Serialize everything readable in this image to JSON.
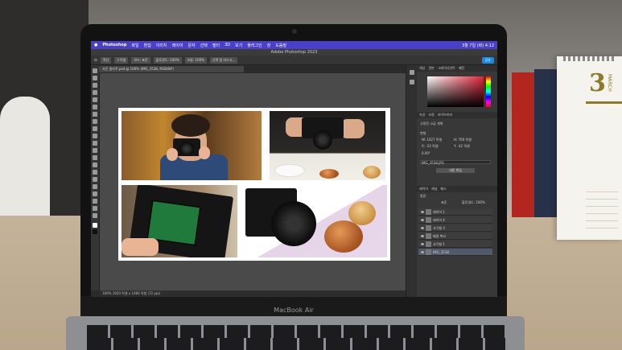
{
  "ps": {
    "menubar": {
      "app_name": "Photoshop",
      "items": [
        "파일",
        "편집",
        "이미지",
        "레이어",
        "문자",
        "선택",
        "필터",
        "3D",
        "보기",
        "플러그인",
        "창",
        "도움말"
      ],
      "clock": "3월 7일 (화) 4:12"
    },
    "window_title": "Adobe Photoshop 2023",
    "doc_tab": "사진 꼴라주.psd @ 100% (IMG_3538, RGB/8#)",
    "options": {
      "chips": [
        "폭선",
        "3 픽셀",
        "모드: 표준",
        "불투명도: 100%",
        "흐름: 100%",
        "선택 및 마스크..."
      ],
      "share_label": "공유"
    },
    "status_bar": "100%   1920 픽셀 x 1080 픽셀 (72 ppi)",
    "color_panel_tabs": [
      "색상",
      "견본",
      "그레이디언트",
      "패턴"
    ],
    "properties": {
      "tabs": [
        "속성",
        "조정",
        "라이브러리"
      ],
      "section": "고급 개체",
      "layer_kind": "고정된 고급 개체",
      "transform_label": "변형",
      "w": "W: 1027 픽셀",
      "h": "H: 760 픽셀",
      "x": "X: -22 픽셀",
      "y": "Y: -42 픽셀",
      "angle": "0.00°",
      "file_name": "IMG_3538.JPG",
      "edit_button": "내용 편집"
    },
    "layers": {
      "tabs": [
        "레이어",
        "채널",
        "패스"
      ],
      "kind": "종류",
      "blend_mode": "표준",
      "opacity": "불투명도: 100%",
      "items": [
        "레이어 1",
        "레이어 4",
        "사각형 3",
        "배경 복사",
        "사각형 1",
        "IMG_3538"
      ]
    }
  },
  "macbook_label": "MacBook Air",
  "calendar": {
    "number": "3",
    "month": "MARCH"
  },
  "colors": {
    "menubar": "#4a3fc8",
    "share": "#1b8ae4",
    "canvas_bg": "#4a4a4a"
  }
}
